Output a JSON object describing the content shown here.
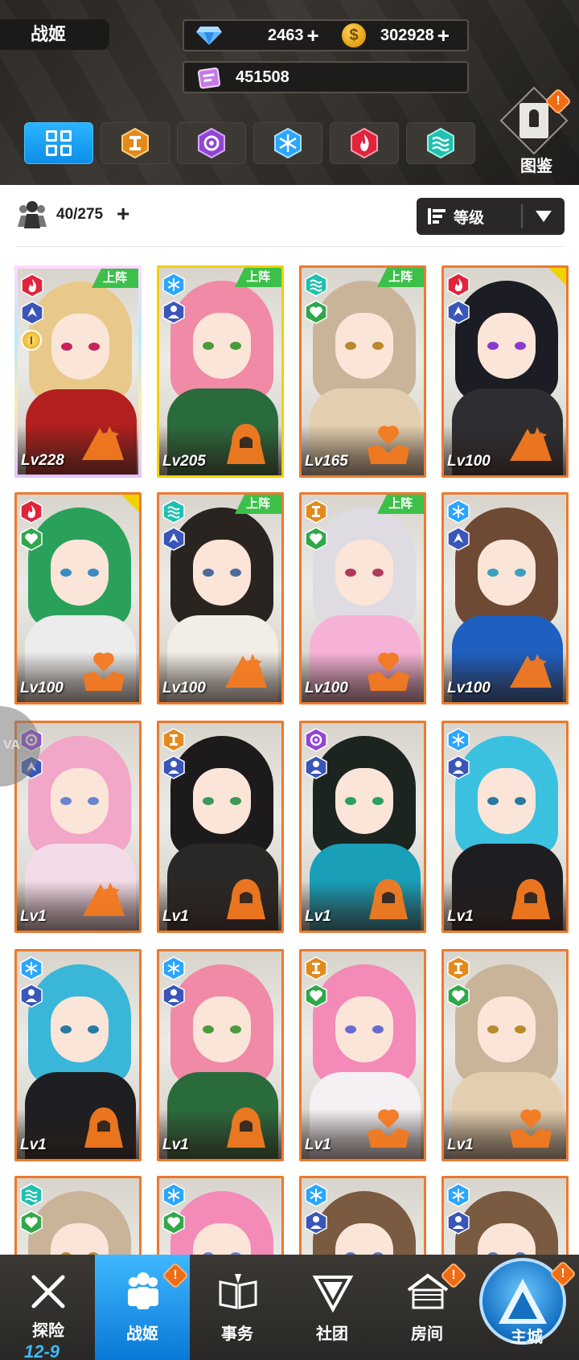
{
  "header": {
    "title": "战姬",
    "gems": "2463",
    "coins": "302928",
    "coin_symbol": "$",
    "tickets": "451508",
    "plus": "+",
    "codex_label": "图鉴",
    "codex_notif": "!"
  },
  "filters": [
    {
      "name": "all",
      "icon": "grid-icon",
      "active": true
    },
    {
      "name": "earth",
      "icon": "earth-element-icon",
      "color": "#e38a1d"
    },
    {
      "name": "dark",
      "icon": "swirl-element-icon",
      "color": "#9245d4"
    },
    {
      "name": "ice",
      "icon": "snowflake-element-icon",
      "color": "#2aa6ff"
    },
    {
      "name": "fire",
      "icon": "flame-element-icon",
      "color": "#e0243c"
    },
    {
      "name": "water",
      "icon": "wave-element-icon",
      "color": "#1fc0b0"
    }
  ],
  "roster": {
    "count": "40/275",
    "plus": "+",
    "sort_label": "等级"
  },
  "cards": [
    {
      "level": "Lv228",
      "deployed": true,
      "element": "fire",
      "cls": "pilot",
      "rank": "I",
      "frame": "rainbow",
      "hair": "#e9c98a",
      "outfit": "#b3201f",
      "eye": "#c8225c"
    },
    {
      "level": "Lv205",
      "deployed": true,
      "element": "ice",
      "cls": "guard",
      "frame": "yellow",
      "hair": "#f08aa6",
      "outfit": "#2a6b3c",
      "eye": "#4a9b3a"
    },
    {
      "level": "Lv165",
      "deployed": true,
      "element": "water",
      "cls": "heal",
      "frame": "orange",
      "hair": "#c9b49a",
      "outfit": "#e3cfb0",
      "eye": "#b88a2c"
    },
    {
      "level": "Lv100",
      "element": "fire",
      "cls": "pilot",
      "frame": "orange",
      "corner": true,
      "hair": "#1c1c24",
      "outfit": "#2e2e32",
      "eye": "#8a3ad0"
    },
    {
      "level": "Lv100",
      "element": "fire",
      "cls": "heal",
      "frame": "orange",
      "corner": true,
      "hair": "#2aa15a",
      "outfit": "#ececec",
      "eye": "#3a8bc0"
    },
    {
      "level": "Lv100",
      "deployed": true,
      "element": "water",
      "cls": "pilot",
      "frame": "orange",
      "hair": "#2a2420",
      "outfit": "#f1eee6",
      "eye": "#4d6aa0"
    },
    {
      "level": "Lv100",
      "deployed": true,
      "element": "earth",
      "cls": "heal",
      "frame": "orange",
      "hair": "#dedbe2",
      "outfit": "#f6b2d6",
      "eye": "#b03a5a"
    },
    {
      "level": "Lv100",
      "element": "ice",
      "cls": "pilot",
      "frame": "orange",
      "hair": "#6e4a34",
      "outfit": "#1f5fc0",
      "eye": "#3aa0c0"
    },
    {
      "level": "Lv1",
      "element": "dark",
      "cls": "pilot",
      "frame": "orange",
      "hair": "#f2a6c8",
      "outfit": "#f4dbe8",
      "eye": "#6a84d0"
    },
    {
      "level": "Lv1",
      "element": "earth",
      "cls": "guard",
      "frame": "orange",
      "hair": "#1c1a1a",
      "outfit": "#2a2826",
      "eye": "#3a9a5a"
    },
    {
      "level": "Lv1",
      "element": "dark",
      "cls": "guard",
      "frame": "orange",
      "hair": "#1c2420",
      "outfit": "#1a9fb8",
      "eye": "#2aa060"
    },
    {
      "level": "Lv1",
      "element": "ice",
      "cls": "guard",
      "frame": "orange",
      "hair": "#3ac1e0",
      "outfit": "#1e1e22",
      "eye": "#2a7aa0"
    },
    {
      "level": "Lv1",
      "element": "ice",
      "cls": "guard",
      "frame": "orange",
      "hair": "#3ab6d8",
      "outfit": "#1e1e22",
      "eye": "#2a7aa0"
    },
    {
      "level": "Lv1",
      "element": "ice",
      "cls": "guard",
      "frame": "orange",
      "hair": "#f08aa6",
      "outfit": "#2a6b3c",
      "eye": "#4a9b3a"
    },
    {
      "level": "Lv1",
      "element": "earth",
      "cls": "heal",
      "frame": "orange",
      "hair": "#f48ab8",
      "outfit": "#f4f0f4",
      "eye": "#6a6ad0"
    },
    {
      "level": "Lv1",
      "element": "earth",
      "cls": "heal",
      "frame": "orange",
      "hair": "#c9b49a",
      "outfit": "#e3cfb0",
      "eye": "#b88a2c"
    },
    {
      "level": "",
      "element": "water",
      "cls": "heal",
      "frame": "orange",
      "hair": "#c9b49a",
      "outfit": "#e3cfb0",
      "eye": "#b88a2c"
    },
    {
      "level": "",
      "element": "ice",
      "cls": "heal",
      "frame": "orange",
      "hair": "#f48ab8",
      "outfit": "#f4dbe8",
      "eye": "#6a84d0"
    },
    {
      "level": "",
      "element": "ice",
      "cls": "guard",
      "frame": "orange",
      "hair": "#7a5a40",
      "outfit": "#eeeae4",
      "eye": "#5a7ab0"
    },
    {
      "level": "",
      "element": "ice",
      "cls": "guard",
      "frame": "orange",
      "hair": "#7a5a40",
      "outfit": "#eeeae4",
      "eye": "#5a7ab0"
    }
  ],
  "deploy_label": "上阵",
  "side_peek_text": "VA",
  "nav": {
    "explore": "探险",
    "explore_level": "12-9",
    "girls": "战姬",
    "affairs": "事务",
    "club": "社团",
    "room": "房间",
    "main_city": "主城",
    "notif": "!"
  },
  "colors": {
    "accent_blue": "#2bb4ff",
    "deploy_green": "#3dc04a",
    "frame_orange": "#ec7a2d",
    "notif_orange": "#ef6b14"
  }
}
